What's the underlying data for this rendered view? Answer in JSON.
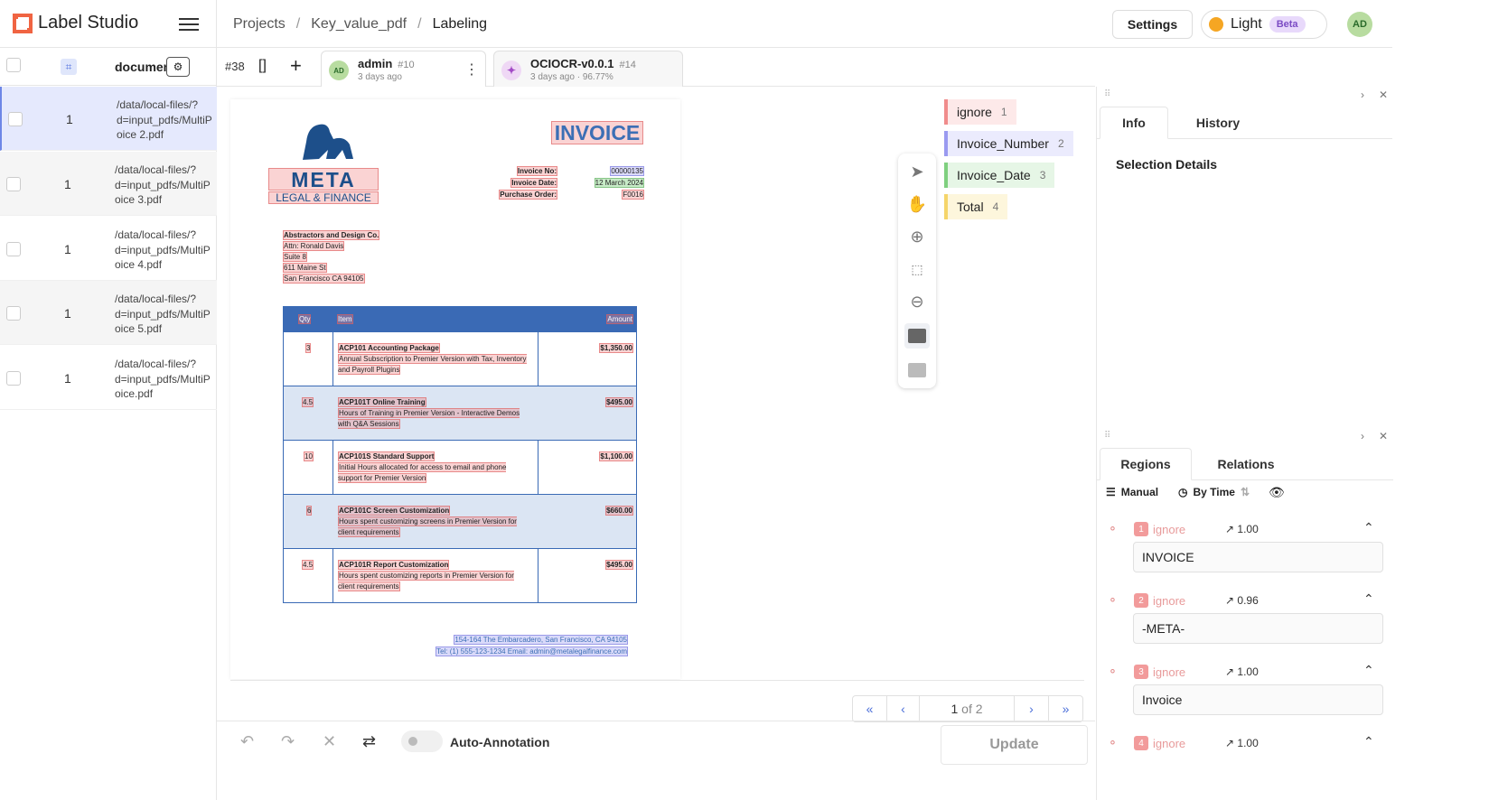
{
  "app": {
    "title": "Label Studio",
    "breadcrumb": [
      "Projects",
      "Key_value_pdf",
      "Labeling"
    ],
    "settings_label": "Settings",
    "theme_label": "Light",
    "beta_label": "Beta",
    "user_initials": "AD"
  },
  "task_list": {
    "header_column": "documen",
    "rows": [
      {
        "count": "1",
        "path": "/data/local-files/?\nd=input_pdfs/MultiP\noice 2.pdf"
      },
      {
        "count": "1",
        "path": "/data/local-files/?\nd=input_pdfs/MultiP\noice 3.pdf"
      },
      {
        "count": "1",
        "path": "/data/local-files/?\nd=input_pdfs/MultiP\noice 4.pdf"
      },
      {
        "count": "1",
        "path": "/data/local-files/?\nd=input_pdfs/MultiP\noice 5.pdf"
      },
      {
        "count": "1",
        "path": "/data/local-files/?\nd=input_pdfs/MultiP\noice.pdf"
      }
    ]
  },
  "annotation_bar": {
    "task_id": "#38",
    "annotations": [
      {
        "initials": "AD",
        "name": "admin",
        "num": "#10",
        "sub": "3 days ago"
      },
      {
        "initials": "✦",
        "name": "OCIOCR-v0.0.1",
        "num": "#14",
        "sub": "3 days ago · 96.77%"
      }
    ]
  },
  "document": {
    "title": "INVOICE",
    "brand": "META",
    "brand_sub": "LEGAL & FINANCE",
    "fields": [
      {
        "label": "Invoice No:",
        "value": "00000135"
      },
      {
        "label": "Invoice Date:",
        "value": "12 March 2024"
      },
      {
        "label": "Purchase Order:",
        "value": "F0016"
      }
    ],
    "address": [
      "Abstractors and Design Co.",
      "Attn: Ronald Davis",
      "Suite 8",
      "611 Maine St",
      "San Francisco CA 94105"
    ],
    "table_headers": [
      "Qty",
      "Item",
      "Amount"
    ],
    "table_rows": [
      {
        "qty": "3",
        "item": "ACP101 Accounting Package",
        "desc": "Annual Subscription to Premier Version with Tax, Inventory and Payroll Plugins",
        "amount": "$1,350.00"
      },
      {
        "qty": "4.5",
        "item": "ACP101T Online Training",
        "desc": "Hours of Training in Premier Version - Interactive Demos with Q&A Sessions",
        "amount": "$495.00"
      },
      {
        "qty": "10",
        "item": "ACP101S Standard Support",
        "desc": "Initial Hours allocated for access to email and phone support for Premier Version",
        "amount": "$1,100.00"
      },
      {
        "qty": "6",
        "item": "ACP101C Screen Customization",
        "desc": "Hours spent customizing screens in Premier Version for client requirements",
        "amount": "$660.00"
      },
      {
        "qty": "4.5",
        "item": "ACP101R Report Customization",
        "desc": "Hours spent customizing reports in Premier Version for client requirements",
        "amount": "$495.00"
      }
    ],
    "footer_address": "154-164 The Embarcadero, San Francisco, CA 94105",
    "footer_contact": "Tel: (1) 555-123-1234  Email: admin@metalegalfinance.com"
  },
  "labels": [
    {
      "name": "ignore",
      "key": "1",
      "color": "#f08c8c"
    },
    {
      "name": "Invoice_Number",
      "key": "2",
      "color": "#9a9af0"
    },
    {
      "name": "Invoice_Date",
      "key": "3",
      "color": "#7fd07f"
    },
    {
      "name": "Total",
      "key": "4",
      "color": "#f5d56a"
    }
  ],
  "pager": {
    "current": "1",
    "of_text": "of 2"
  },
  "bottom": {
    "auto_annotation": "Auto-Annotation",
    "update": "Update"
  },
  "right_panel": {
    "tabs_top": [
      "Info",
      "History"
    ],
    "selection_details": "Selection Details",
    "tabs_bottom": [
      "Regions",
      "Relations"
    ],
    "filters": {
      "manual": "Manual",
      "by_time": "By Time"
    },
    "regions": [
      {
        "idx": "1",
        "label": "ignore",
        "score": "1.00",
        "text": "INVOICE"
      },
      {
        "idx": "2",
        "label": "ignore",
        "score": "0.96",
        "text": "-META-"
      },
      {
        "idx": "3",
        "label": "ignore",
        "score": "1.00",
        "text": "Invoice"
      },
      {
        "idx": "4",
        "label": "ignore",
        "score": "1.00",
        "text": ""
      }
    ]
  }
}
